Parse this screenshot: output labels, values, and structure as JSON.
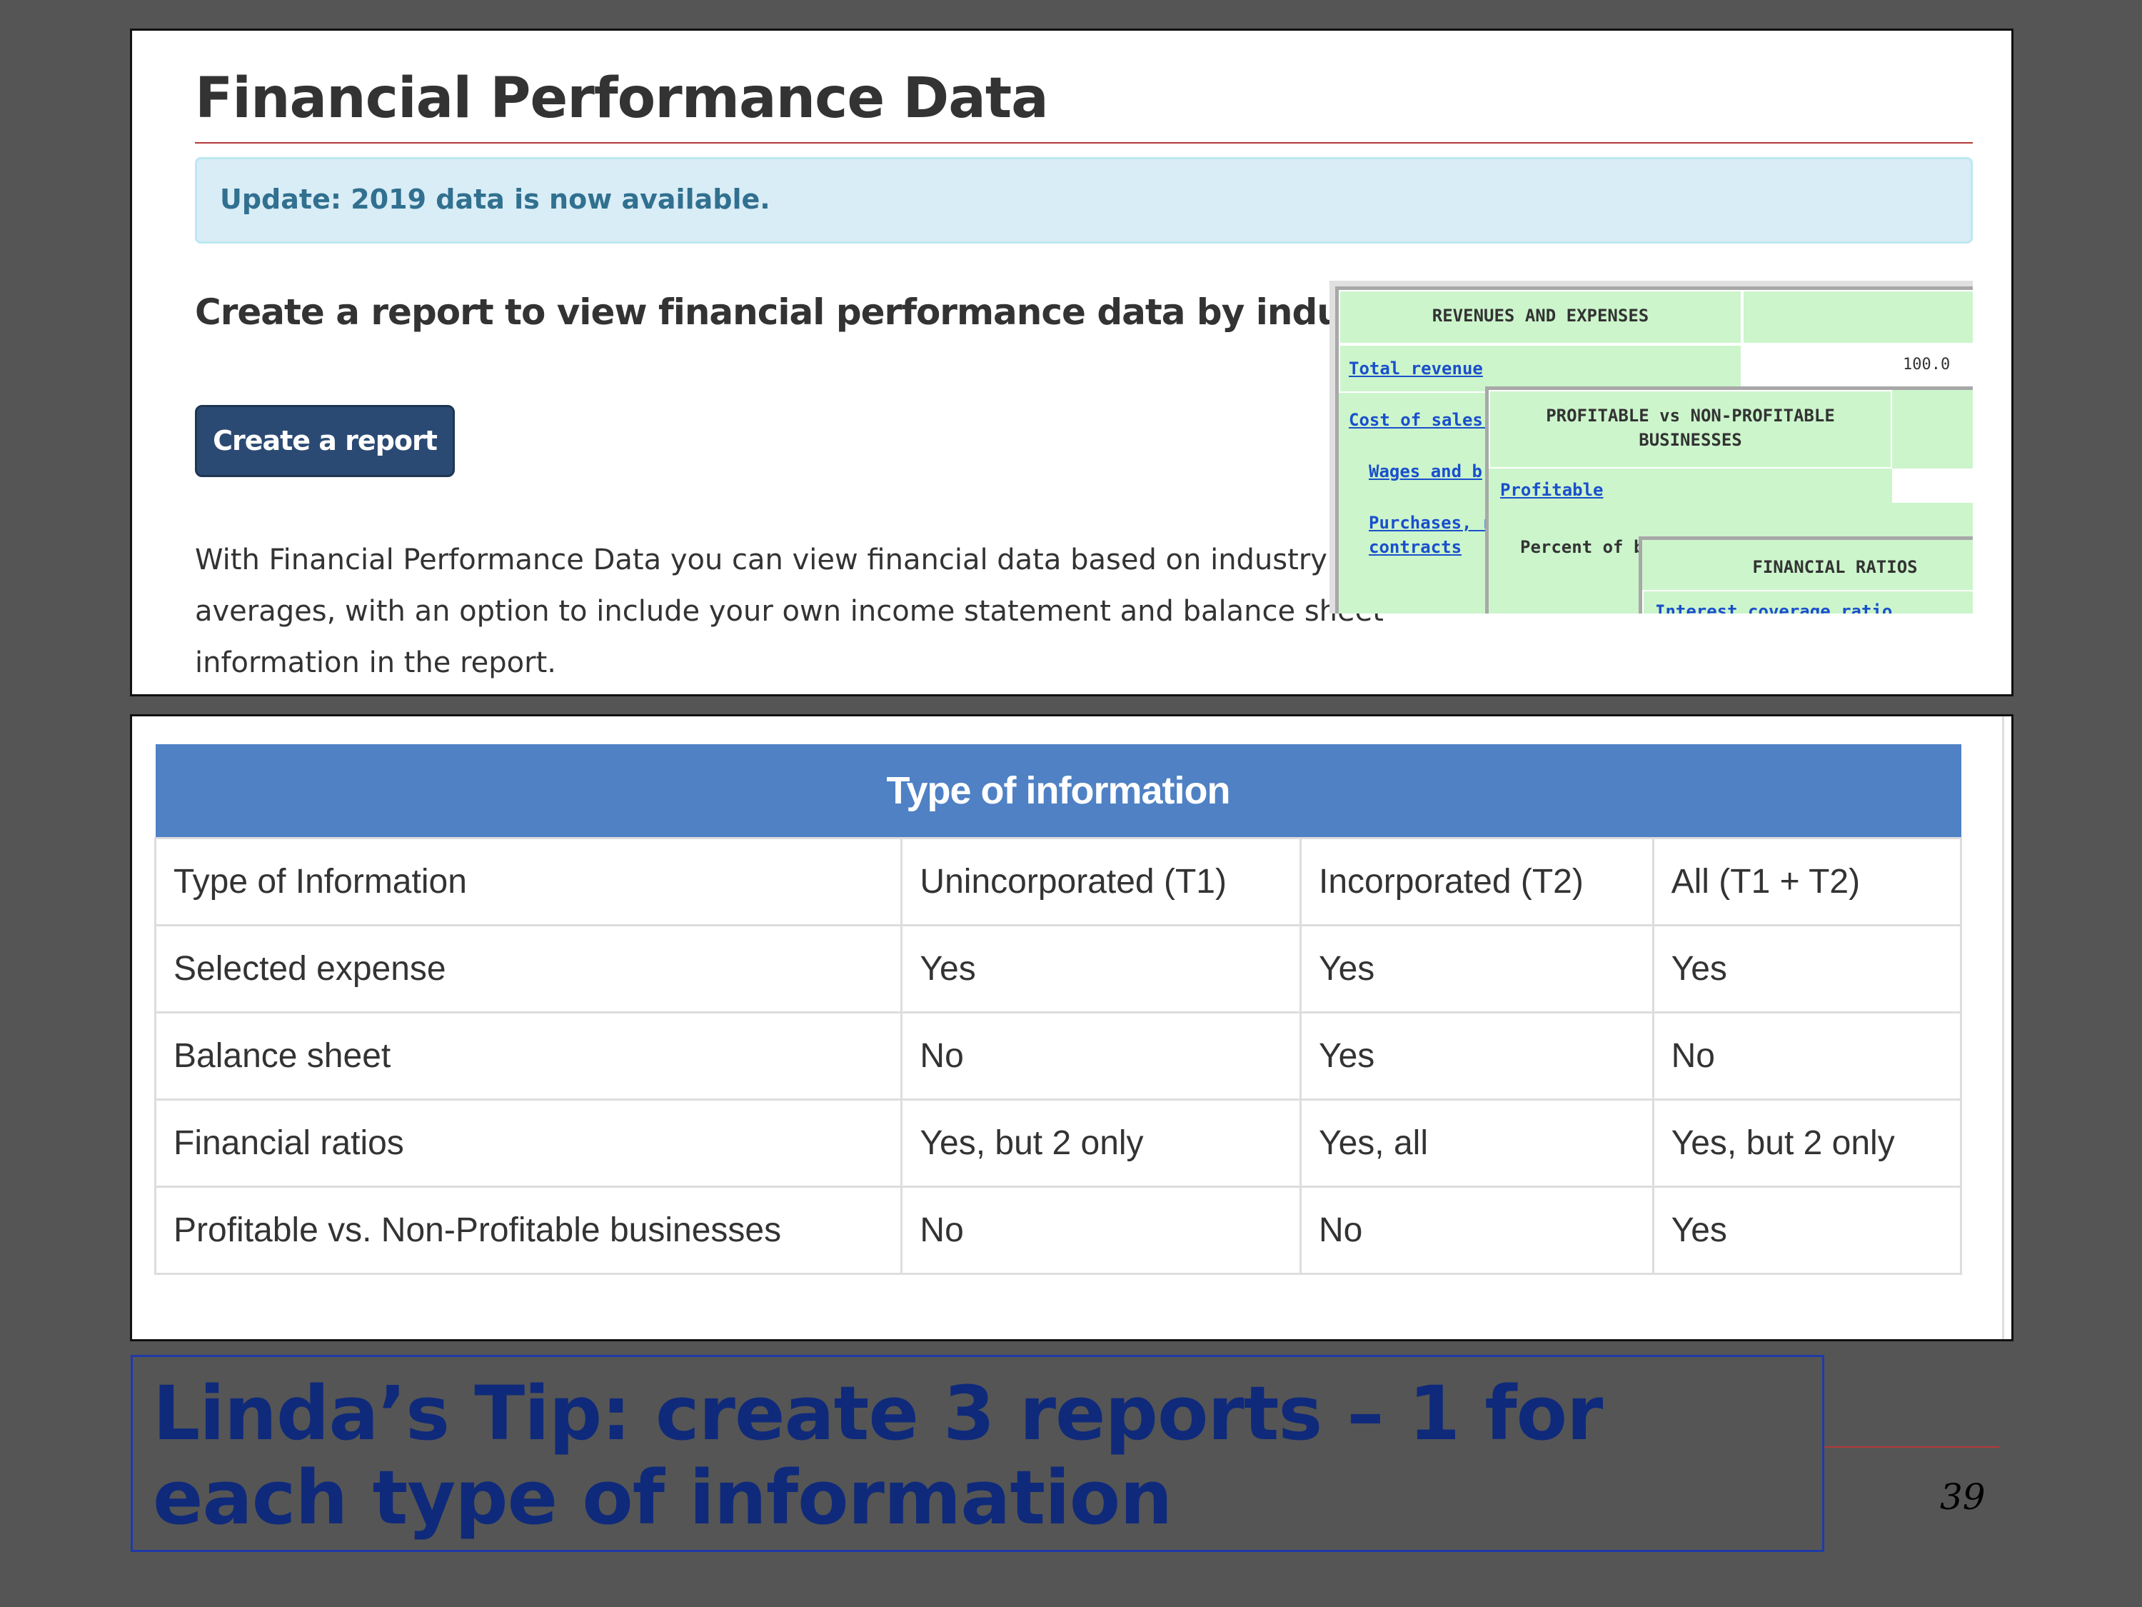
{
  "page": {
    "title": "Financial Performance Data",
    "alert": "Update: 2019 data is now available.",
    "subheading": "Create a report to view financial performance data by industry",
    "create_button": "Create a report",
    "description": "With Financial Performance Data you can view financial data based on industry averages, with an option to include your own income statement and balance sheet information in the report."
  },
  "thumbnail": {
    "box1": {
      "heading": "REVENUES AND EXPENSES",
      "total_revenue": "Total revenue",
      "total_revenue_value": "100.0",
      "cost_of_sales": "Cost of sales (",
      "wages": "Wages and b",
      "purchases": "Purchases, r",
      "contracts": "contracts"
    },
    "box2": {
      "heading_line1": "PROFITABLE vs NON-PROFITABLE",
      "heading_line2": "BUSINESSES",
      "profitable": "Profitable",
      "percent_of": "Percent of b"
    },
    "box3": {
      "heading": "FINANCIAL RATIOS",
      "interest_coverage": "Interest coverage ratio"
    }
  },
  "table": {
    "caption": "Type of information",
    "rows": [
      [
        "Type of Information",
        "Unincorporated (T1)",
        "Incorporated (T2)",
        "All (T1 + T2)"
      ],
      [
        "Selected expense",
        "Yes",
        "Yes",
        "Yes"
      ],
      [
        "Balance sheet",
        "No",
        "Yes",
        "No"
      ],
      [
        "Financial ratios",
        "Yes, but 2 only",
        "Yes, all",
        "Yes, but 2 only"
      ],
      [
        "Profitable vs. Non-Profitable businesses",
        "No",
        "No",
        "Yes"
      ]
    ]
  },
  "tip": "Linda’s Tip: create 3 reports – 1 for each type of information",
  "page_number": "39"
}
